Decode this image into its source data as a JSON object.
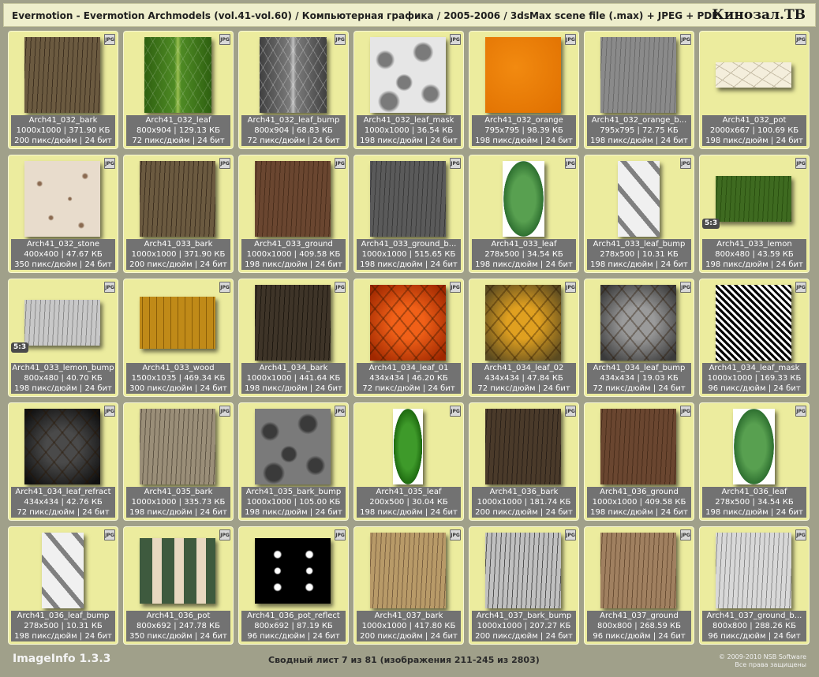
{
  "header": {
    "title": "Evermotion - Evermotion Archmodels (vol.41-vol.60) / Компьютерная графика / 2005-2006 / 3dsMax scene file (.max) + JPEG + PDF",
    "brand": "Кинозал.ТВ"
  },
  "icons": {
    "format_badge": "JPG"
  },
  "thumbs": [
    {
      "name": "Arch41_032_bark",
      "dims": "1000x1000 | 371.90 КБ",
      "meta": "200 пикс/дюйм | 24 бит",
      "colors": [
        "#6b5a40",
        "#3e3020"
      ],
      "pattern": "noise",
      "aspect": 1,
      "ratio": ""
    },
    {
      "name": "Arch41_032_leaf",
      "dims": "800x904 | 129.13 КБ",
      "meta": "72 пикс/дюйм | 24 бит",
      "colors": [
        "#4e8a24",
        "#2e6010"
      ],
      "pattern": "leaf",
      "aspect": 0.885,
      "ratio": ""
    },
    {
      "name": "Arch41_032_leaf_bump",
      "dims": "800x904 | 68.83 КБ",
      "meta": "72 пикс/дюйм | 24 бит",
      "colors": [
        "#7a7a7a",
        "#404040"
      ],
      "pattern": "leafgray",
      "aspect": 0.885,
      "ratio": ""
    },
    {
      "name": "Arch41_032_leaf_mask",
      "dims": "1000x1000 | 36.54 КБ",
      "meta": "198 пикс/дюйм | 24 бит",
      "colors": [
        "#e6e6e6",
        "#7a7a7a"
      ],
      "pattern": "blobs",
      "aspect": 1,
      "ratio": ""
    },
    {
      "name": "Arch41_032_orange",
      "dims": "795x795 | 98.39 КБ",
      "meta": "198 пикс/дюйм | 24 бит",
      "colors": [
        "#f28a10",
        "#e07000"
      ],
      "pattern": "flat",
      "aspect": 1,
      "ratio": ""
    },
    {
      "name": "Arch41_032_orange_b...",
      "dims": "795x795 | 72.75 КБ",
      "meta": "198 пикс/дюйм | 24 бит",
      "colors": [
        "#8a8a8a",
        "#6a6a6a"
      ],
      "pattern": "noise",
      "aspect": 1,
      "ratio": ""
    },
    {
      "name": "Arch41_032_pot",
      "dims": "2000x667 | 100.69 КБ",
      "meta": "198 пикс/дюйм | 24 бит",
      "colors": [
        "#f4eedc",
        "#c8bfa8"
      ],
      "pattern": "crackle",
      "aspect": 3,
      "ratio": ""
    },
    {
      "name": "Arch41_032_stone",
      "dims": "400x400 | 47.67 КБ",
      "meta": "350 пикс/дюйм | 24 бит",
      "colors": [
        "#e8dccc",
        "#8a6a50"
      ],
      "pattern": "speckle",
      "aspect": 1,
      "ratio": ""
    },
    {
      "name": "Arch41_033_bark",
      "dims": "1000x1000 | 371.90 КБ",
      "meta": "200 пикс/дюйм | 24 бит",
      "colors": [
        "#6b5a40",
        "#3e3020"
      ],
      "pattern": "noise",
      "aspect": 1,
      "ratio": ""
    },
    {
      "name": "Arch41_033_ground",
      "dims": "1000x1000 | 409.58 КБ",
      "meta": "198 пикс/дюйм | 24 бит",
      "colors": [
        "#6a4630",
        "#4a2e1c"
      ],
      "pattern": "noise",
      "aspect": 1,
      "ratio": ""
    },
    {
      "name": "Arch41_033_ground_b...",
      "dims": "1000x1000 | 515.65 КБ",
      "meta": "198 пикс/дюйм | 24 бит",
      "colors": [
        "#5a5a5a",
        "#3a3a3a"
      ],
      "pattern": "noise",
      "aspect": 1,
      "ratio": ""
    },
    {
      "name": "Arch41_033_leaf",
      "dims": "278x500 | 34.54 КБ",
      "meta": "198 пикс/дюйм | 24 бит",
      "colors": [
        "#58a050",
        "#2e7030"
      ],
      "pattern": "leafshape",
      "aspect": 0.556,
      "ratio": ""
    },
    {
      "name": "Arch41_033_leaf_bump",
      "dims": "278x500 | 10.31 КБ",
      "meta": "198 пикс/дюйм | 24 бит",
      "colors": [
        "#f0f0f0",
        "#808080"
      ],
      "pattern": "braid",
      "aspect": 0.556,
      "ratio": ""
    },
    {
      "name": "Arch41_033_lemon",
      "dims": "800x480 | 43.59 КБ",
      "meta": "198 пикс/дюйм | 24 бит",
      "colors": [
        "#3e6a20",
        "#2a5010"
      ],
      "pattern": "noise",
      "aspect": 1.667,
      "ratio": "5:3"
    },
    {
      "name": "Arch41_033_lemon_bump",
      "dims": "800x480 | 40.70 КБ",
      "meta": "198 пикс/дюйм | 24 бит",
      "colors": [
        "#c8c8c8",
        "#8a8a8a"
      ],
      "pattern": "noise",
      "aspect": 1.667,
      "ratio": "5:3"
    },
    {
      "name": "Arch41_033_wood",
      "dims": "1500x1035 | 469.34 КБ",
      "meta": "300 пикс/дюйм | 24 бит",
      "colors": [
        "#c08a18",
        "#8a5e08"
      ],
      "pattern": "wood",
      "aspect": 1.449,
      "ratio": ""
    },
    {
      "name": "Arch41_034_bark",
      "dims": "1000x1000 | 441.64 КБ",
      "meta": "198 пикс/дюйм | 24 бит",
      "colors": [
        "#3e3428",
        "#1e1810"
      ],
      "pattern": "noise",
      "aspect": 1,
      "ratio": ""
    },
    {
      "name": "Arch41_034_leaf_01",
      "dims": "434x434 | 46.20 КБ",
      "meta": "72 пикс/дюйм | 24 бит",
      "colors": [
        "#f06018",
        "#a02800"
      ],
      "pattern": "leafveins",
      "aspect": 1,
      "ratio": ""
    },
    {
      "name": "Arch41_034_leaf_02",
      "dims": "434x434 | 47.84 КБ",
      "meta": "72 пикс/дюйм | 24 бит",
      "colors": [
        "#e0a020",
        "#5a4a20"
      ],
      "pattern": "leafveins",
      "aspect": 1,
      "ratio": ""
    },
    {
      "name": "Arch41_034_leaf_bump",
      "dims": "434x434 | 19.03 КБ",
      "meta": "72 пикс/дюйм | 24 бит",
      "colors": [
        "#9a9a9a",
        "#3a3a3a"
      ],
      "pattern": "leafveins",
      "aspect": 1,
      "ratio": ""
    },
    {
      "name": "Arch41_034_leaf_mask",
      "dims": "1000x1000 | 169.33 КБ",
      "meta": "96 пикс/дюйм | 24 бит",
      "colors": [
        "#ffffff",
        "#000000"
      ],
      "pattern": "bw",
      "aspect": 1,
      "ratio": ""
    },
    {
      "name": "Arch41_034_leaf_refract",
      "dims": "434x434 | 42.76 КБ",
      "meta": "72 пикс/дюйм | 24 бит",
      "colors": [
        "#4a4a4a",
        "#101010"
      ],
      "pattern": "leafveins",
      "aspect": 1,
      "ratio": ""
    },
    {
      "name": "Arch41_035_bark",
      "dims": "1000x1000 | 335.73 КБ",
      "meta": "198 пикс/дюйм | 24 бит",
      "colors": [
        "#9a8e78",
        "#5e5444"
      ],
      "pattern": "noise",
      "aspect": 1,
      "ratio": ""
    },
    {
      "name": "Arch41_035_bark_bump",
      "dims": "1000x1000 | 105.00 КБ",
      "meta": "198 пикс/дюйм | 24 бит",
      "colors": [
        "#7a7a7a",
        "#3a3a3a"
      ],
      "pattern": "blobs",
      "aspect": 1,
      "ratio": ""
    },
    {
      "name": "Arch41_035_leaf",
      "dims": "200x500 | 30.04 КБ",
      "meta": "198 пикс/дюйм | 24 бит",
      "colors": [
        "#3e9a2a",
        "#1e6a10"
      ],
      "pattern": "leafshape",
      "aspect": 0.4,
      "ratio": ""
    },
    {
      "name": "Arch41_036_bark",
      "dims": "1000x1000 | 181.74 КБ",
      "meta": "200 пикс/дюйм | 24 бит",
      "colors": [
        "#4a3a2a",
        "#2a2018"
      ],
      "pattern": "noise",
      "aspect": 1,
      "ratio": ""
    },
    {
      "name": "Arch41_036_ground",
      "dims": "1000x1000 | 409.58 КБ",
      "meta": "198 пикс/дюйм | 24 бит",
      "colors": [
        "#6a4630",
        "#4a2e1c"
      ],
      "pattern": "noise",
      "aspect": 1,
      "ratio": ""
    },
    {
      "name": "Arch41_036_leaf",
      "dims": "278x500 | 34.54 КБ",
      "meta": "198 пикс/дюйм | 24 бит",
      "colors": [
        "#58a050",
        "#2e7030"
      ],
      "pattern": "leafshape",
      "aspect": 0.556,
      "ratio": ""
    },
    {
      "name": "Arch41_036_leaf_bump",
      "dims": "278x500 | 10.31 КБ",
      "meta": "198 пикс/дюйм | 24 бит",
      "colors": [
        "#f0f0f0",
        "#808080"
      ],
      "pattern": "braid",
      "aspect": 0.556,
      "ratio": ""
    },
    {
      "name": "Arch41_036_pot",
      "dims": "800x692 | 247.78 КБ",
      "meta": "350 пикс/дюйм | 24 бит",
      "colors": [
        "#3e5a3e",
        "#e8d8c0"
      ],
      "pattern": "stripes",
      "aspect": 1.156,
      "ratio": ""
    },
    {
      "name": "Arch41_036_pot_reflect",
      "dims": "800x692 | 87.19 КБ",
      "meta": "96 пикс/дюйм | 24 бит",
      "colors": [
        "#000000",
        "#ffffff"
      ],
      "pattern": "floral",
      "aspect": 1.156,
      "ratio": ""
    },
    {
      "name": "Arch41_037_bark",
      "dims": "1000x1000 | 417.80 КБ",
      "meta": "200 пикс/дюйм | 24 бит",
      "colors": [
        "#b89a68",
        "#7a6040"
      ],
      "pattern": "noise",
      "aspect": 1,
      "ratio": ""
    },
    {
      "name": "Arch41_037_bark_bump",
      "dims": "1000x1000 | 207.27 КБ",
      "meta": "200 пикс/дюйм | 24 бит",
      "colors": [
        "#c0c0c0",
        "#505050"
      ],
      "pattern": "noise",
      "aspect": 1,
      "ratio": ""
    },
    {
      "name": "Arch41_037_ground",
      "dims": "800x800 | 268.59 КБ",
      "meta": "96 пикс/дюйм | 24 бит",
      "colors": [
        "#a08060",
        "#6a4e34"
      ],
      "pattern": "noise",
      "aspect": 1,
      "ratio": ""
    },
    {
      "name": "Arch41_037_ground_b...",
      "dims": "800x800 | 288.26 КБ",
      "meta": "96 пикс/дюйм | 24 бит",
      "colors": [
        "#d8d8d8",
        "#8a8a8a"
      ],
      "pattern": "noise",
      "aspect": 1,
      "ratio": ""
    }
  ],
  "footer": {
    "app_name": "ImageInfo 1.3.3",
    "sheet_info": "Сводный лист 7 из 81 (изображения 211-245 из 2803)",
    "copyright": "© 2009-2010 NSB Software",
    "rights": "Все права защищены"
  }
}
